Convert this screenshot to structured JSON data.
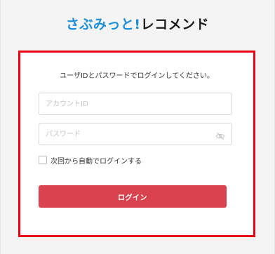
{
  "brand": {
    "name_primary": "さぶみっと!",
    "name_secondary": "レコメンド",
    "primary_color": "#1e8ed6"
  },
  "login": {
    "instruction": "ユーザIDとパスワードでログインしてください。",
    "account_placeholder": "アカウントID",
    "password_placeholder": "パスワード",
    "password_toggle_icon": "eye-slash-icon",
    "remember_label": "次回から自動でログインする",
    "remember_checked": false,
    "submit_label": "ログイン",
    "submit_color": "#d9434f",
    "highlight_border_color": "#e60012"
  }
}
